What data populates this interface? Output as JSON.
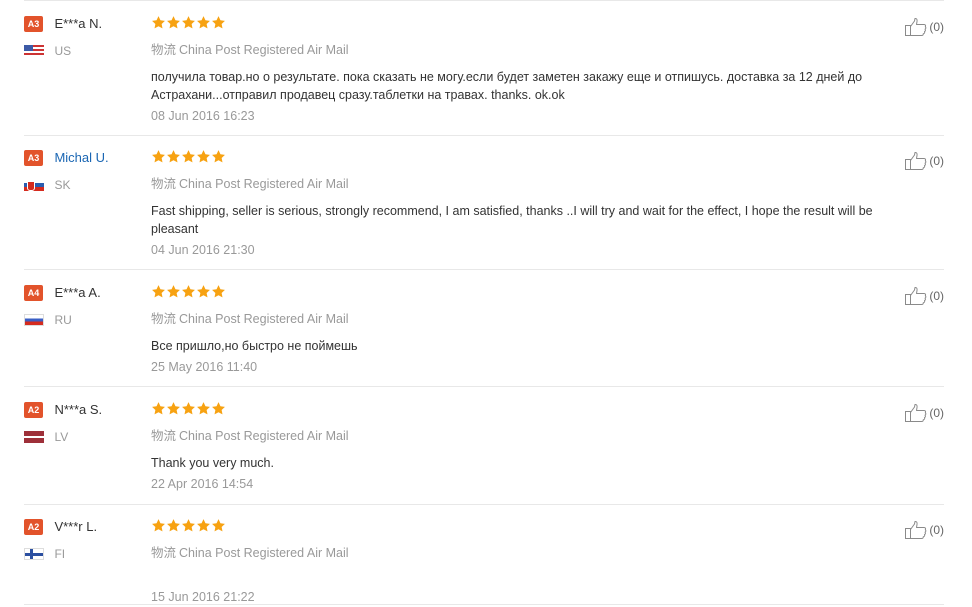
{
  "reviews": [
    {
      "badge": "A3",
      "name": "E***a N.",
      "name_is_link": false,
      "country": "US",
      "flag": "us",
      "rating": 5,
      "logistics_label": "物流",
      "logistics": "China Post Registered Air Mail",
      "feedback": "получила товар.но о результате. пока сказать не могу.если будет заметен закажу еще и отпишусь. доставка за 12 дней до Астрахани...отправил продавец сразу.таблетки на травах. thanks. ok.ok",
      "date": "08 Jun 2016 16:23",
      "helpful": "(0)"
    },
    {
      "badge": "A3",
      "name": "Michal U.",
      "name_is_link": true,
      "country": "SK",
      "flag": "sk",
      "rating": 5,
      "logistics_label": "物流",
      "logistics": "China Post Registered Air Mail",
      "feedback": "Fast shipping, seller is serious, strongly recommend, I am satisfied, thanks ..I will try and wait for the effect, I hope the result will be pleasant",
      "date": "04 Jun 2016 21:30",
      "helpful": "(0)"
    },
    {
      "badge": "A4",
      "name": "E***a A.",
      "name_is_link": false,
      "country": "RU",
      "flag": "ru",
      "rating": 5,
      "logistics_label": "物流",
      "logistics": "China Post Registered Air Mail",
      "feedback": "Все пришло,но быстро не поймешь",
      "date": "25 May 2016 11:40",
      "helpful": "(0)"
    },
    {
      "badge": "A2",
      "name": "N***a S.",
      "name_is_link": false,
      "country": "LV",
      "flag": "lv",
      "rating": 5,
      "logistics_label": "物流",
      "logistics": "China Post Registered Air Mail",
      "feedback": "Thank you very much.",
      "date": "22 Apr 2016 14:54",
      "helpful": "(0)"
    },
    {
      "badge": "A2",
      "name": "V***r L.",
      "name_is_link": false,
      "country": "FI",
      "flag": "fi",
      "rating": 5,
      "logistics_label": "物流",
      "logistics": "China Post Registered Air Mail",
      "feedback": "",
      "date": "15 Jun 2016 21:22",
      "helpful": "(0)"
    }
  ],
  "icons": {
    "star": "star-icon",
    "helpful": "thumbs-up-icon"
  },
  "colors": {
    "badge": "#e2532b",
    "star": "#f7a212",
    "link": "#1a66b3",
    "muted": "#999999"
  }
}
